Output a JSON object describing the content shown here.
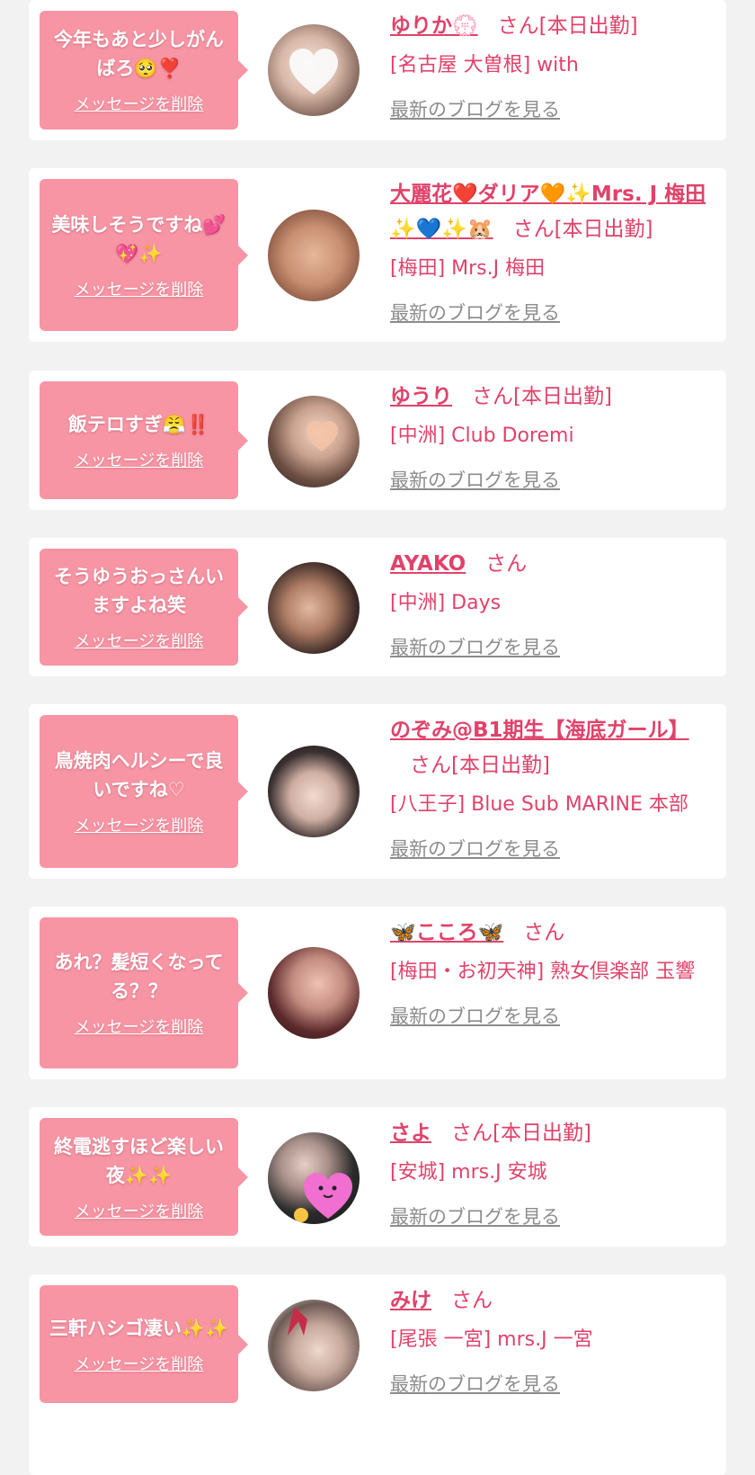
{
  "items": [
    {
      "message": "今年もあと少しがんばろ🥺❣️",
      "delete_label": "メッセージを削除",
      "name": "ゆりか💮",
      "suffix": "さん[本日出勤]",
      "shop": "[名古屋 大曽根] with",
      "blog_link": "最新のブログを見る"
    },
    {
      "message": "美味しそうですね💕💖✨",
      "delete_label": "メッセージを削除",
      "name": "大麗花❤️ダリア🧡✨Mrs. J 梅田✨💙✨🐹",
      "suffix": "さん[本日出勤]",
      "shop": "[梅田] Mrs.J 梅田",
      "blog_link": "最新のブログを見る"
    },
    {
      "message": "飯テロすぎ😤‼️",
      "delete_label": "メッセージを削除",
      "name": "ゆうり",
      "suffix": "さん[本日出勤]",
      "shop": "[中洲] Club Doremi",
      "blog_link": "最新のブログを見る"
    },
    {
      "message": "そうゆうおっさんいますよね笑",
      "delete_label": "メッセージを削除",
      "name": "AYAKO",
      "suffix": "さん",
      "shop": "[中洲] Days",
      "blog_link": "最新のブログを見る"
    },
    {
      "message": "鳥焼肉ヘルシーで良いですね♡",
      "delete_label": "メッセージを削除",
      "name": "のぞみ@B1期生【海底ガール】",
      "suffix": "さん[本日出勤]",
      "shop": "[八王子] Blue Sub MARINE 本部",
      "blog_link": "最新のブログを見る"
    },
    {
      "message": "あれ？髪短くなってる？？",
      "delete_label": "メッセージを削除",
      "name": "🦋こころ🦋",
      "suffix": "さん",
      "shop": "[梅田・お初天神] 熟女倶楽部 玉響",
      "blog_link": "最新のブログを見る"
    },
    {
      "message": "終電逃すほど楽しい夜✨✨",
      "delete_label": "メッセージを削除",
      "name": "さよ",
      "suffix": "さん[本日出勤]",
      "shop": "[安城] mrs.J 安城",
      "blog_link": "最新のブログを見る"
    },
    {
      "message": "三軒ハシゴ凄い✨✨",
      "delete_label": "メッセージを削除",
      "name": "みけ",
      "suffix": "さん",
      "shop": "[尾張 一宮] mrs.J 一宮",
      "blog_link": "最新のブログを見る"
    }
  ],
  "colors": {
    "page_bg": "#f2f2f2",
    "bubble": "#f795a4",
    "accent": "#e0426a",
    "link_gray": "#8c8c8c"
  }
}
